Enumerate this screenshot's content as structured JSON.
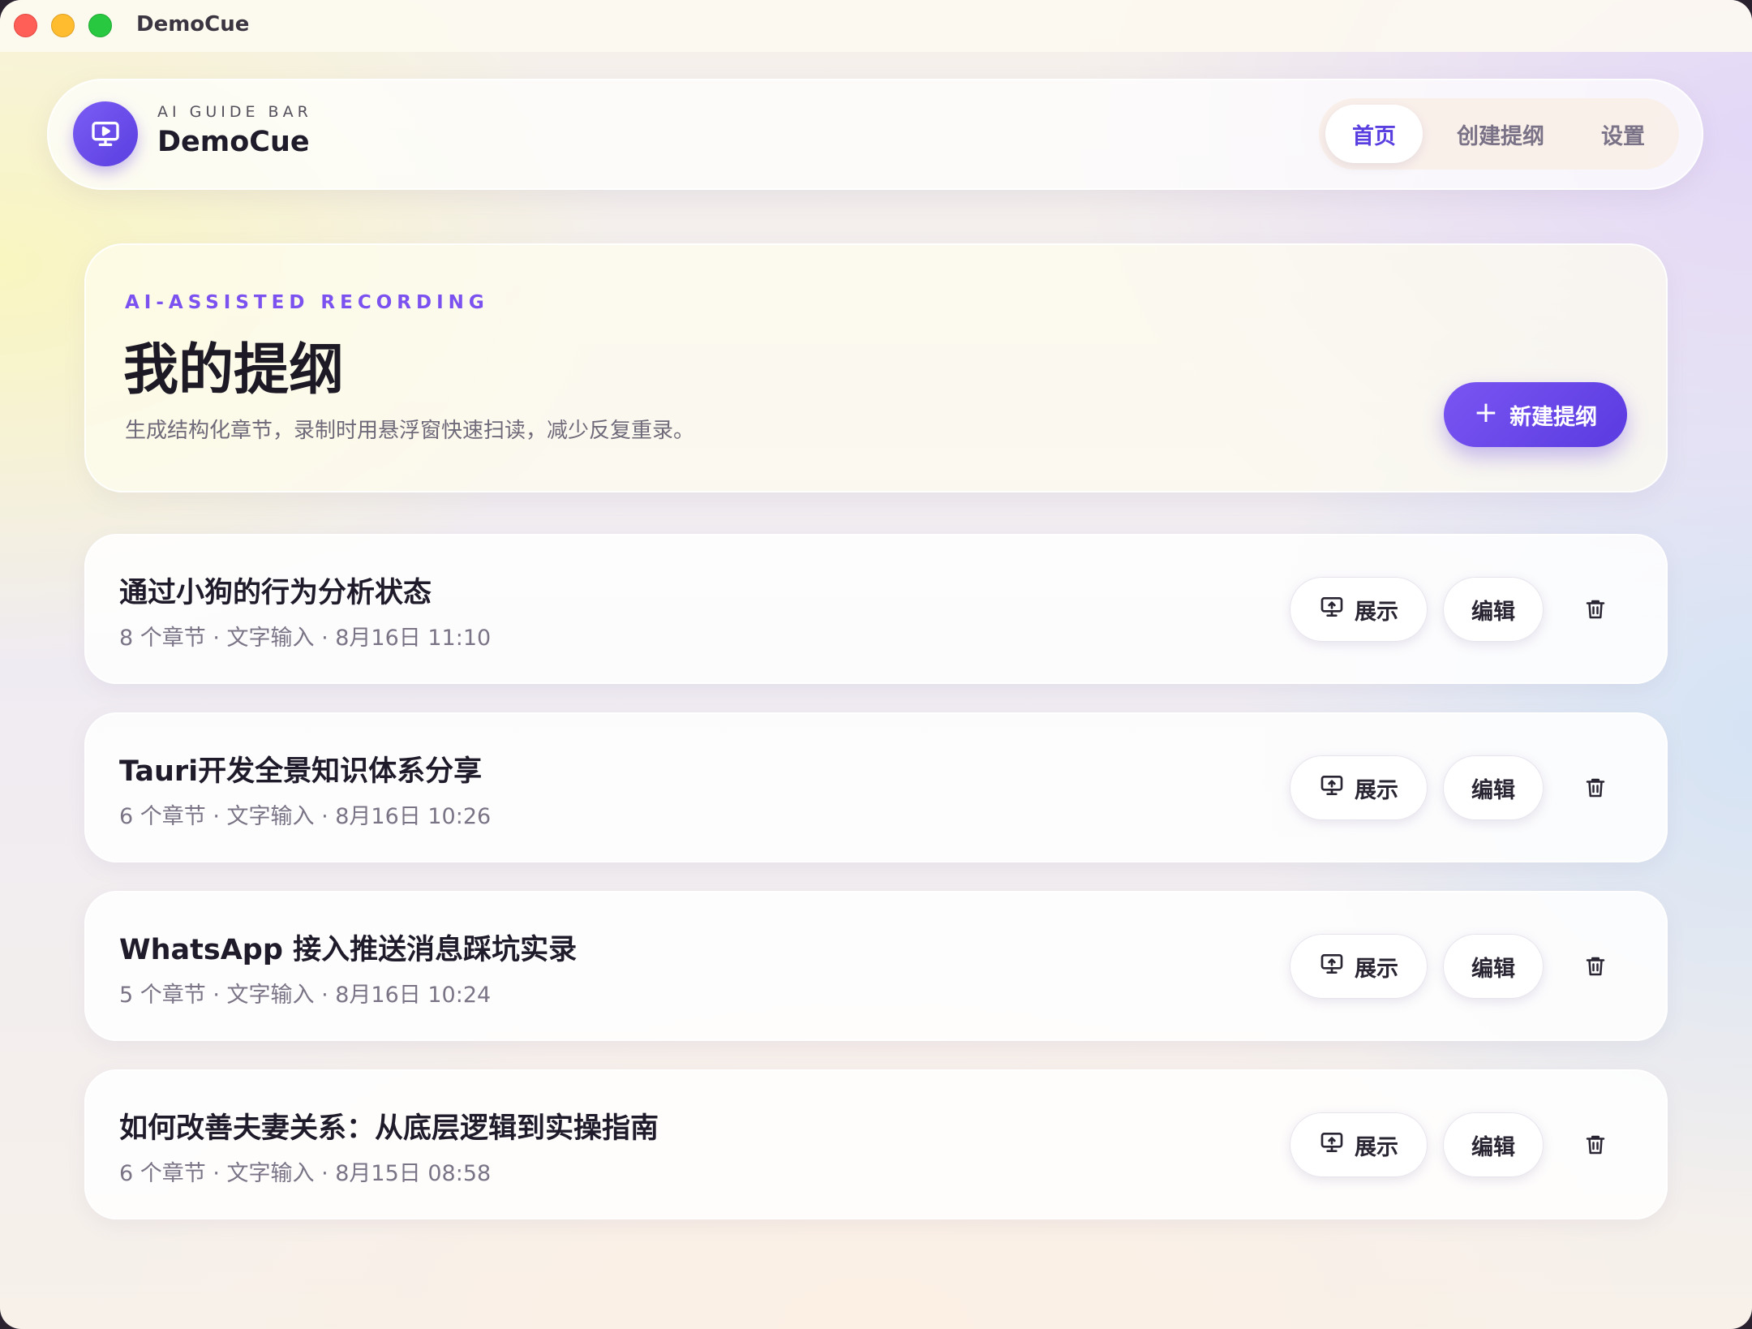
{
  "window": {
    "title": "DemoCue"
  },
  "header": {
    "subtitle": "AI GUIDE BAR",
    "title": "DemoCue",
    "logo_icon": "monitor-play-icon",
    "nav": [
      {
        "label": "首页",
        "active": true
      },
      {
        "label": "创建提纲",
        "active": false
      },
      {
        "label": "设置",
        "active": false
      }
    ]
  },
  "hero": {
    "kicker": "AI-ASSISTED RECORDING",
    "title": "我的提纲",
    "description": "生成结构化章节，录制时用悬浮窗快速扫读，减少反复重录。",
    "new_button": "新建提纲"
  },
  "outlines": [
    {
      "title": "通过小狗的行为分析状态",
      "meta": "8 个章节 · 文字输入 · 8月16日 11:10",
      "show_label": "展示",
      "edit_label": "编辑"
    },
    {
      "title": "Tauri开发全景知识体系分享",
      "meta": "6 个章节 · 文字输入 · 8月16日 10:26",
      "show_label": "展示",
      "edit_label": "编辑"
    },
    {
      "title": "WhatsApp 接入推送消息踩坑实录",
      "meta": "5 个章节 · 文字输入 · 8月16日 10:24",
      "show_label": "展示",
      "edit_label": "编辑"
    },
    {
      "title": "如何改善夫妻关系：从底层逻辑到实操指南",
      "meta": "6 个章节 · 文字输入 · 8月15日 08:58",
      "show_label": "展示",
      "edit_label": "编辑"
    }
  ],
  "colors": {
    "accent": "#5a3fe0",
    "accent_light": "#7b52f0"
  }
}
